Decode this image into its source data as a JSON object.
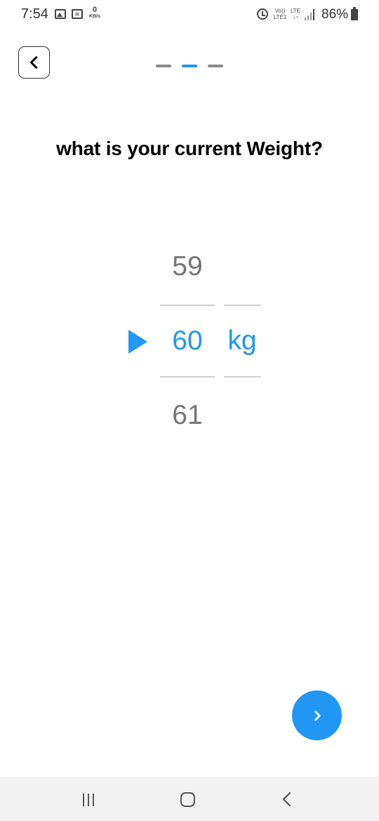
{
  "status_bar": {
    "time": "7:54",
    "data_rate_value": "0",
    "data_rate_unit": "KB/s",
    "volte_line1": "Vo))",
    "volte_line2": "LTE1",
    "lte_line1": "LTE",
    "lte_line2": "↓↑",
    "battery_percent": "86%",
    "icons": [
      "gallery-icon",
      "wifi-icon",
      "alarm-icon",
      "signal-icon",
      "battery-icon"
    ]
  },
  "header": {
    "back_icon": "chevron-left-icon",
    "progress": {
      "total_steps": 3,
      "current_step": 2,
      "active_color": "#2196F3",
      "inactive_color": "#8a8a8a"
    }
  },
  "question": "what is your current Weight?",
  "picker": {
    "previous_value": "59",
    "current_value": "60",
    "next_value": "61",
    "unit": "kg",
    "pointer_icon": "triangle-right-icon",
    "selected_color": "#2196F3",
    "unselected_color": "#757575"
  },
  "next_button": {
    "icon": "chevron-right-icon",
    "color": "#2196F3"
  },
  "nav_bar": {
    "icons": [
      "recents-icon",
      "home-icon",
      "back-icon"
    ]
  }
}
